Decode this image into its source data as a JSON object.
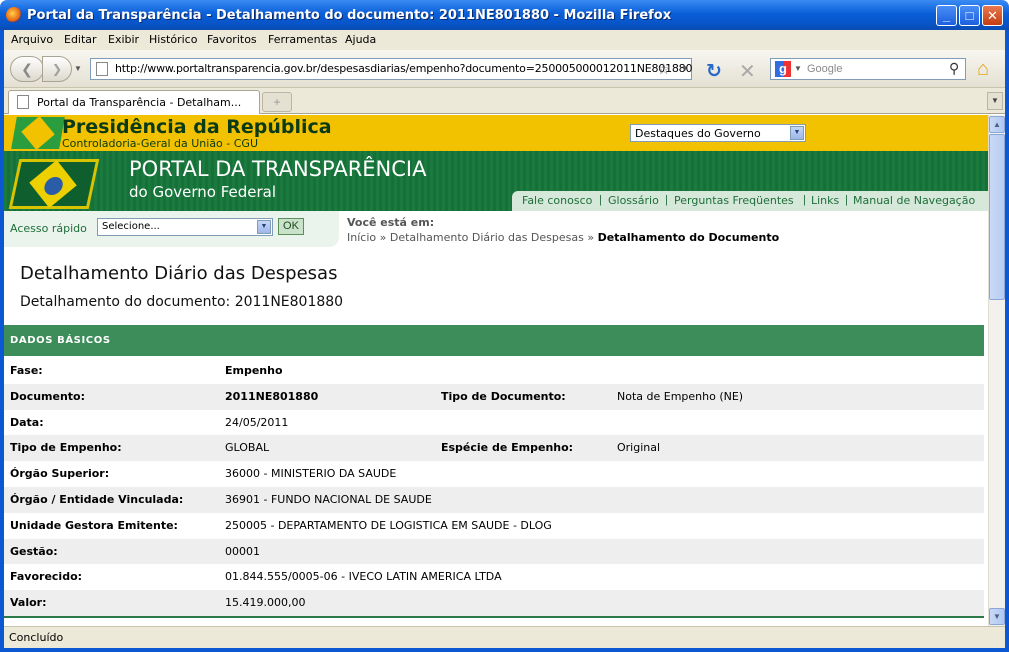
{
  "window": {
    "title": "Portal da Transparência - Detalhamento do documento: 2011NE801880 - Mozilla Firefox"
  },
  "menu": [
    "Arquivo",
    "Editar",
    "Exibir",
    "Histórico",
    "Favoritos",
    "Ferramentas",
    "Ajuda"
  ],
  "navbar": {
    "url": "http://www.portaltransparencia.gov.br/despesasdiarias/empenho?documento=250005000012011NE801880",
    "search_placeholder": "Google"
  },
  "tab": {
    "label": "Portal da Transparência - Detalham...",
    "new_tab": "+"
  },
  "header": {
    "presidencia": "Presidência da República",
    "cgu": "Controladoria-Geral da União - CGU",
    "destaques": "Destaques do Governo",
    "portal_title": "PORTAL DA TRANSPARÊNCIA",
    "portal_sub": "do Governo Federal",
    "links": [
      "Fale conosco",
      "Glossário",
      "Perguntas Freqüentes",
      "Links",
      "Manual de Navegação"
    ]
  },
  "quick_access": {
    "label": "Acesso rápido",
    "select_value": "Selecione...",
    "ok": "OK"
  },
  "breadcrumb": {
    "label": "Você está em:",
    "items": [
      "Início",
      "Detalhamento Diário das Despesas",
      "Detalhamento do Documento"
    ],
    "sep": "»"
  },
  "page": {
    "title": "Detalhamento Diário das Despesas",
    "subtitle": "Detalhamento do documento: 2011NE801880",
    "section": "DADOS BÁSICOS"
  },
  "rows": [
    {
      "label": "Fase:",
      "value": "Empenho",
      "bold": true
    },
    {
      "label": "Documento:",
      "value": "2011NE801880",
      "bold": true,
      "label2": "Tipo de Documento:",
      "value2": "Nota de Empenho (NE)"
    },
    {
      "label": "Data:",
      "value": "24/05/2011"
    },
    {
      "label": "Tipo de Empenho:",
      "value": "GLOBAL",
      "label2": "Espécie de Empenho:",
      "value2": "Original"
    },
    {
      "label": "Órgão Superior:",
      "value": "36000 - MINISTERIO DA SAUDE"
    },
    {
      "label": "Órgão / Entidade Vinculada:",
      "value": "36901 - FUNDO NACIONAL DE SAUDE"
    },
    {
      "label": "Unidade Gestora Emitente:",
      "value": "250005 - DEPARTAMENTO DE LOGISTICA EM SAUDE - DLOG"
    },
    {
      "label": "Gestão:",
      "value": "00001"
    },
    {
      "label": "Favorecido:",
      "value": "01.844.555/0005-06 - IVECO LATIN AMERICA LTDA"
    },
    {
      "label": "Valor:",
      "value": "15.419.000,00"
    }
  ],
  "status": "Concluído"
}
